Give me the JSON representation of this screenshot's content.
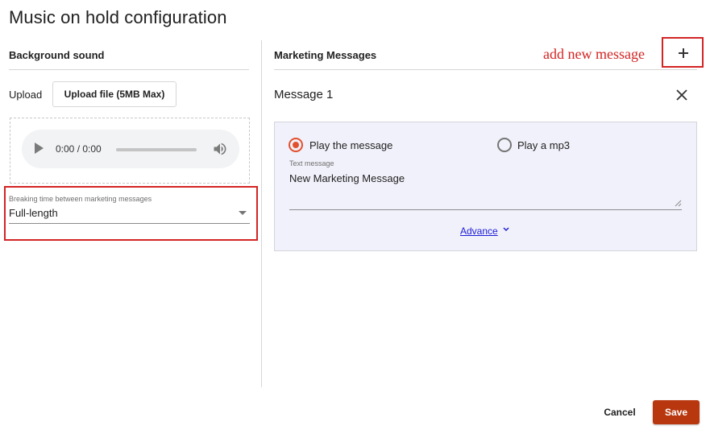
{
  "page": {
    "title": "Music on hold configuration"
  },
  "background_sound": {
    "title": "Background sound",
    "upload_label": "Upload",
    "upload_button": "Upload file (5MB Max)",
    "audio": {
      "time": "0:00 / 0:00",
      "play_icon": "play-icon",
      "volume_icon": "volume-icon",
      "progress": 0
    },
    "breaking_time": {
      "label": "Breaking time between marketing messages",
      "value": "Full-length"
    }
  },
  "marketing": {
    "title": "Marketing Messages",
    "annotation": "add new message",
    "add_icon": "plus-icon",
    "message": {
      "title": "Message 1",
      "close_icon": "close-icon",
      "options": [
        {
          "label": "Play the message",
          "checked": true
        },
        {
          "label": "Play a mp3",
          "checked": false
        }
      ],
      "text_label": "Text message",
      "text_value": "New Marketing Message",
      "advance_label": "Advance",
      "advance_icon": "chevron-down-icon"
    }
  },
  "footer": {
    "cancel": "Cancel",
    "save": "Save"
  },
  "colors": {
    "accent": "#b8370f",
    "highlight": "#d32424",
    "radio": "#e2512e",
    "link": "#1a1ad6",
    "panel": "#f1f1fb"
  }
}
